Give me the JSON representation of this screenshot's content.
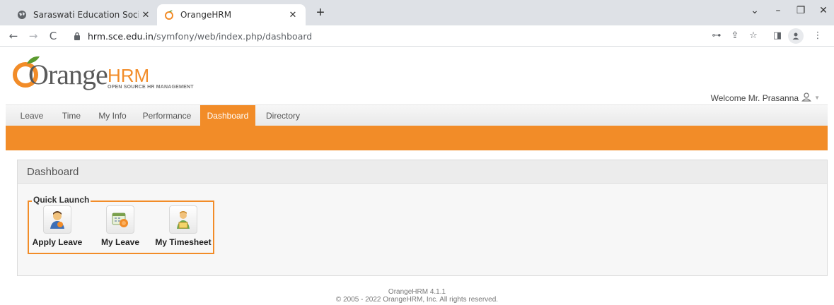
{
  "browser": {
    "tabs": [
      {
        "title": "Saraswati Education Society",
        "icon": "globe-icon",
        "active": false
      },
      {
        "title": "OrangeHRM",
        "icon": "orangehrm-favicon",
        "active": true
      }
    ],
    "new_tab": "+",
    "window_controls": {
      "dropdown": "⌄",
      "minimize": "–",
      "restore": "❐",
      "close": "✕"
    },
    "url_host": "hrm.sce.edu.in",
    "url_path": "/symfony/web/index.php/dashboard",
    "nav": {
      "back": "←",
      "forward": "→",
      "reload": "C"
    },
    "toolbar": {
      "key": "⊶",
      "share": "⇪",
      "star": "☆",
      "sidebar": "◨",
      "menu": "⋮"
    }
  },
  "header": {
    "logo": {
      "brand": "Orange",
      "hrm": "HRM",
      "tagline": "OPEN SOURCE HR MANAGEMENT"
    },
    "welcome": "Welcome Mr. Prasanna"
  },
  "menu": {
    "items": [
      {
        "label": "Leave",
        "active": false
      },
      {
        "label": "Time",
        "active": false
      },
      {
        "label": "My Info",
        "active": false
      },
      {
        "label": "Performance",
        "active": false
      },
      {
        "label": "Dashboard",
        "active": true
      },
      {
        "label": "Directory",
        "active": false
      }
    ]
  },
  "dashboard": {
    "title": "Dashboard",
    "quick_launch": {
      "legend": "Quick Launch",
      "items": [
        {
          "label": "Apply Leave",
          "icon": "apply-leave-icon"
        },
        {
          "label": "My Leave",
          "icon": "my-leave-icon"
        },
        {
          "label": "My Timesheet",
          "icon": "my-timesheet-icon"
        }
      ]
    }
  },
  "footer": {
    "version": "OrangeHRM 4.1.1",
    "copyright": "© 2005 - 2022 OrangeHRM, Inc. All rights reserved."
  },
  "colors": {
    "accent": "#f28c28",
    "menu_bg": "#eeeeee",
    "panel_bg": "#f7f7f7"
  }
}
